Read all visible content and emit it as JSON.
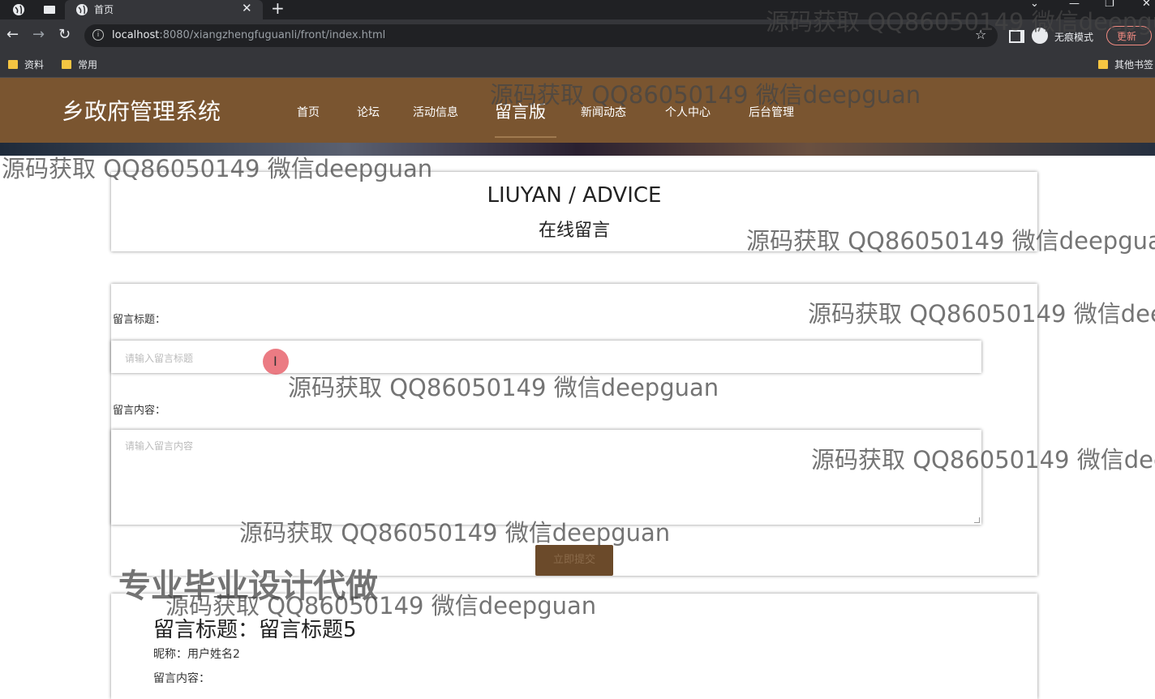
{
  "browser": {
    "tab_title": "首页",
    "url_host": "localhost",
    "url_rest": ":8080/xiangzhengfuguanli/front/index.html",
    "incognito_label": "无痕模式",
    "update_label": "更新",
    "bookmarks": [
      "资料",
      "常用"
    ],
    "other_bookmarks": "其他书签"
  },
  "site": {
    "logo": "乡政府管理系统",
    "nav": [
      "首页",
      "论坛",
      "活动信息",
      "留言版",
      "新闻动态",
      "个人中心",
      "后台管理"
    ],
    "active_nav": "留言版"
  },
  "page": {
    "title_en": "LIUYAN / ADVICE",
    "title_cn": "在线留言"
  },
  "form": {
    "title_label": "留言标题：",
    "title_placeholder": "请输入留言标题",
    "content_label": "留言内容：",
    "content_placeholder": "请输入留言内容",
    "submit_label": "立即提交"
  },
  "message": {
    "title": "留言标题：留言标题5",
    "nickname": "昵称：用户姓名2",
    "content_label": "留言内容："
  },
  "overlay": {
    "watermark": "源码获取 QQ86050149 微信deepguan",
    "promo": "专业毕业设计代做"
  },
  "colors": {
    "header_bg": "#7a5530",
    "button_bg": "#6b4a2a",
    "chrome_bg": "#35363a"
  }
}
